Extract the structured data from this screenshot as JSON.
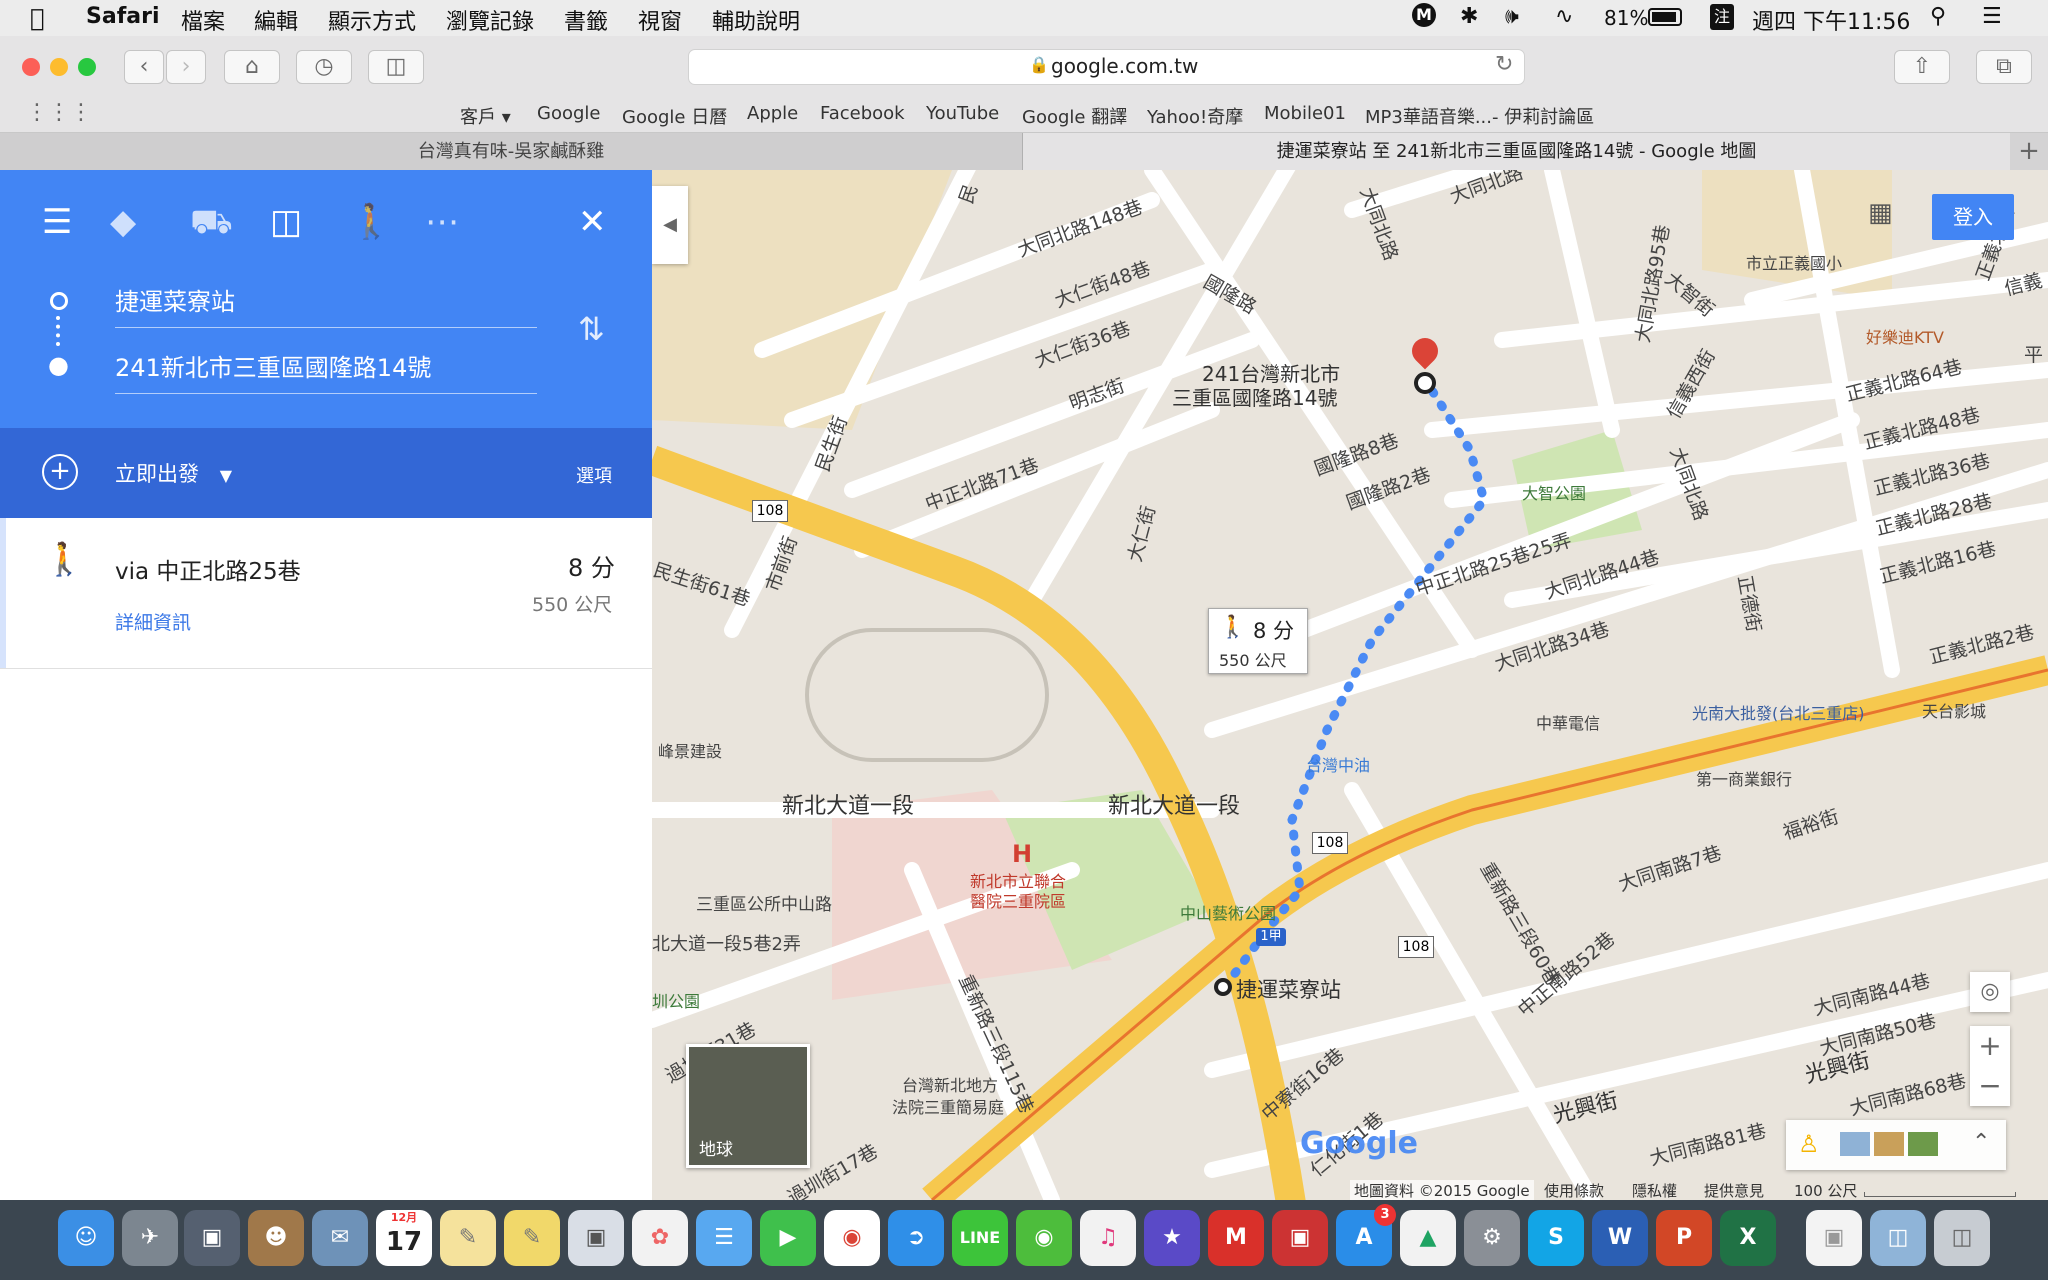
{
  "menubar": {
    "apple_icon": "apple-icon",
    "app_name": "Safari",
    "menus": [
      "檔案",
      "編輯",
      "顯示方式",
      "瀏覽記錄",
      "書籤",
      "視窗",
      "輔助說明"
    ],
    "battery": "81%",
    "input_method": "注",
    "clock": "週四 下午11:56"
  },
  "toolbar": {
    "url": "google.com.tw"
  },
  "bookmarks": [
    "客戶",
    "Google",
    "Google 日曆",
    "Apple",
    "Facebook",
    "YouTube",
    "Google 翻譯",
    "Yahoo!奇摩",
    "Mobile01",
    "MP3華語音樂...- 伊莉討論區"
  ],
  "tabs": [
    {
      "title": "台灣真有味-吳家鹹酥雞"
    },
    {
      "title": "捷運菜寮站 至 241新北市三重區國隆路14號 - Google 地圖"
    }
  ],
  "directions": {
    "origin": "捷運菜寮站",
    "destination": "241新北市三重區國隆路14號",
    "depart_label": "立即出發",
    "options_label": "選項",
    "route": {
      "via": "via 中正北路25巷",
      "time": "8 分",
      "distance": "550 公尺",
      "details_link": "詳細資訊"
    }
  },
  "map": {
    "signin_label": "登入",
    "callout_time": "8 分",
    "callout_distance": "550 公尺",
    "dest_label_line1": "241台灣新北市",
    "dest_label_line2": "三重區國隆路14號",
    "origin_label": "捷運菜寮站",
    "hospital_mark": "H",
    "route_shield": "108",
    "route_shield_2": "1甲",
    "earth_label": "地球",
    "google_logo": "Google",
    "footer": [
      "地圖資料 ©2015 Google",
      "使用條款",
      "隱私權",
      "提供意見",
      "100 公尺"
    ],
    "labels": {
      "l1": "大同北路148巷",
      "l2": "大仁街48巷",
      "l3": "大仁街36巷",
      "l4": "明志街",
      "l5": "國隆路",
      "l6": "國隆路8巷",
      "l7": "國隆路2巷",
      "l8": "中正北路71巷",
      "l9": "大仁街",
      "l10": "民生街",
      "l11": "市前街",
      "l12": "民生街61巷",
      "l13": "中正北路25巷25弄",
      "l14": "大同北路44巷",
      "l15": "大同北路34巷",
      "l16": "新北大道一段",
      "l17": "新北大道一段",
      "l18": "峰景建設",
      "l19": "台灣中油",
      "l20": "中華電信",
      "l21": "光南大批發(台北三重店)",
      "l22": "天台影城",
      "l23": "第一商業銀行",
      "l24": "福裕街",
      "l25": "大同南路7巷",
      "l26": "重新路三段60巷",
      "l27": "中正南路52巷",
      "l28": "大同南路44巷",
      "l29": "大同南路50巷",
      "l30": "光興街",
      "l31": "大同南路68巷",
      "l32": "大同南路81巷",
      "l33": "光興街",
      "l34": "中寮街16巷",
      "l35": "重新路三段115巷",
      "l36": "台灣新北地方",
      "l37": "法院三重簡易庭",
      "l38": "新北市立聯合",
      "l39": "醫院三重院區",
      "l40": "中山藝術公園",
      "l41": "三重區公所中山路",
      "l42": "北大道一段5巷2弄",
      "l43": "圳公園",
      "l44": "過圳街31巷",
      "l45": "大智公園",
      "l46": "市立正義國小",
      "l47": "好樂迪KTV",
      "l48": "正義北路64巷",
      "l49": "正義北路48巷",
      "l50": "正義北路36巷",
      "l51": "正義北路28巷",
      "l52": "正義北路16巷",
      "l53": "正義北路2巷",
      "l54": "大同北路95巷",
      "l55": "大智街",
      "l56": "信義西街",
      "l57": "大同北路",
      "l58": "正德街",
      "l59": "大同北路",
      "l60": "信義",
      "l61": "大同北路",
      "l62": "平",
      "l63": "正義北路",
      "l64": "過圳街17巷",
      "l65": "仁化街1巷",
      "l66": "民"
    }
  },
  "dock": {
    "calendar_month": "12月",
    "calendar_day": "17",
    "badge": "3"
  }
}
